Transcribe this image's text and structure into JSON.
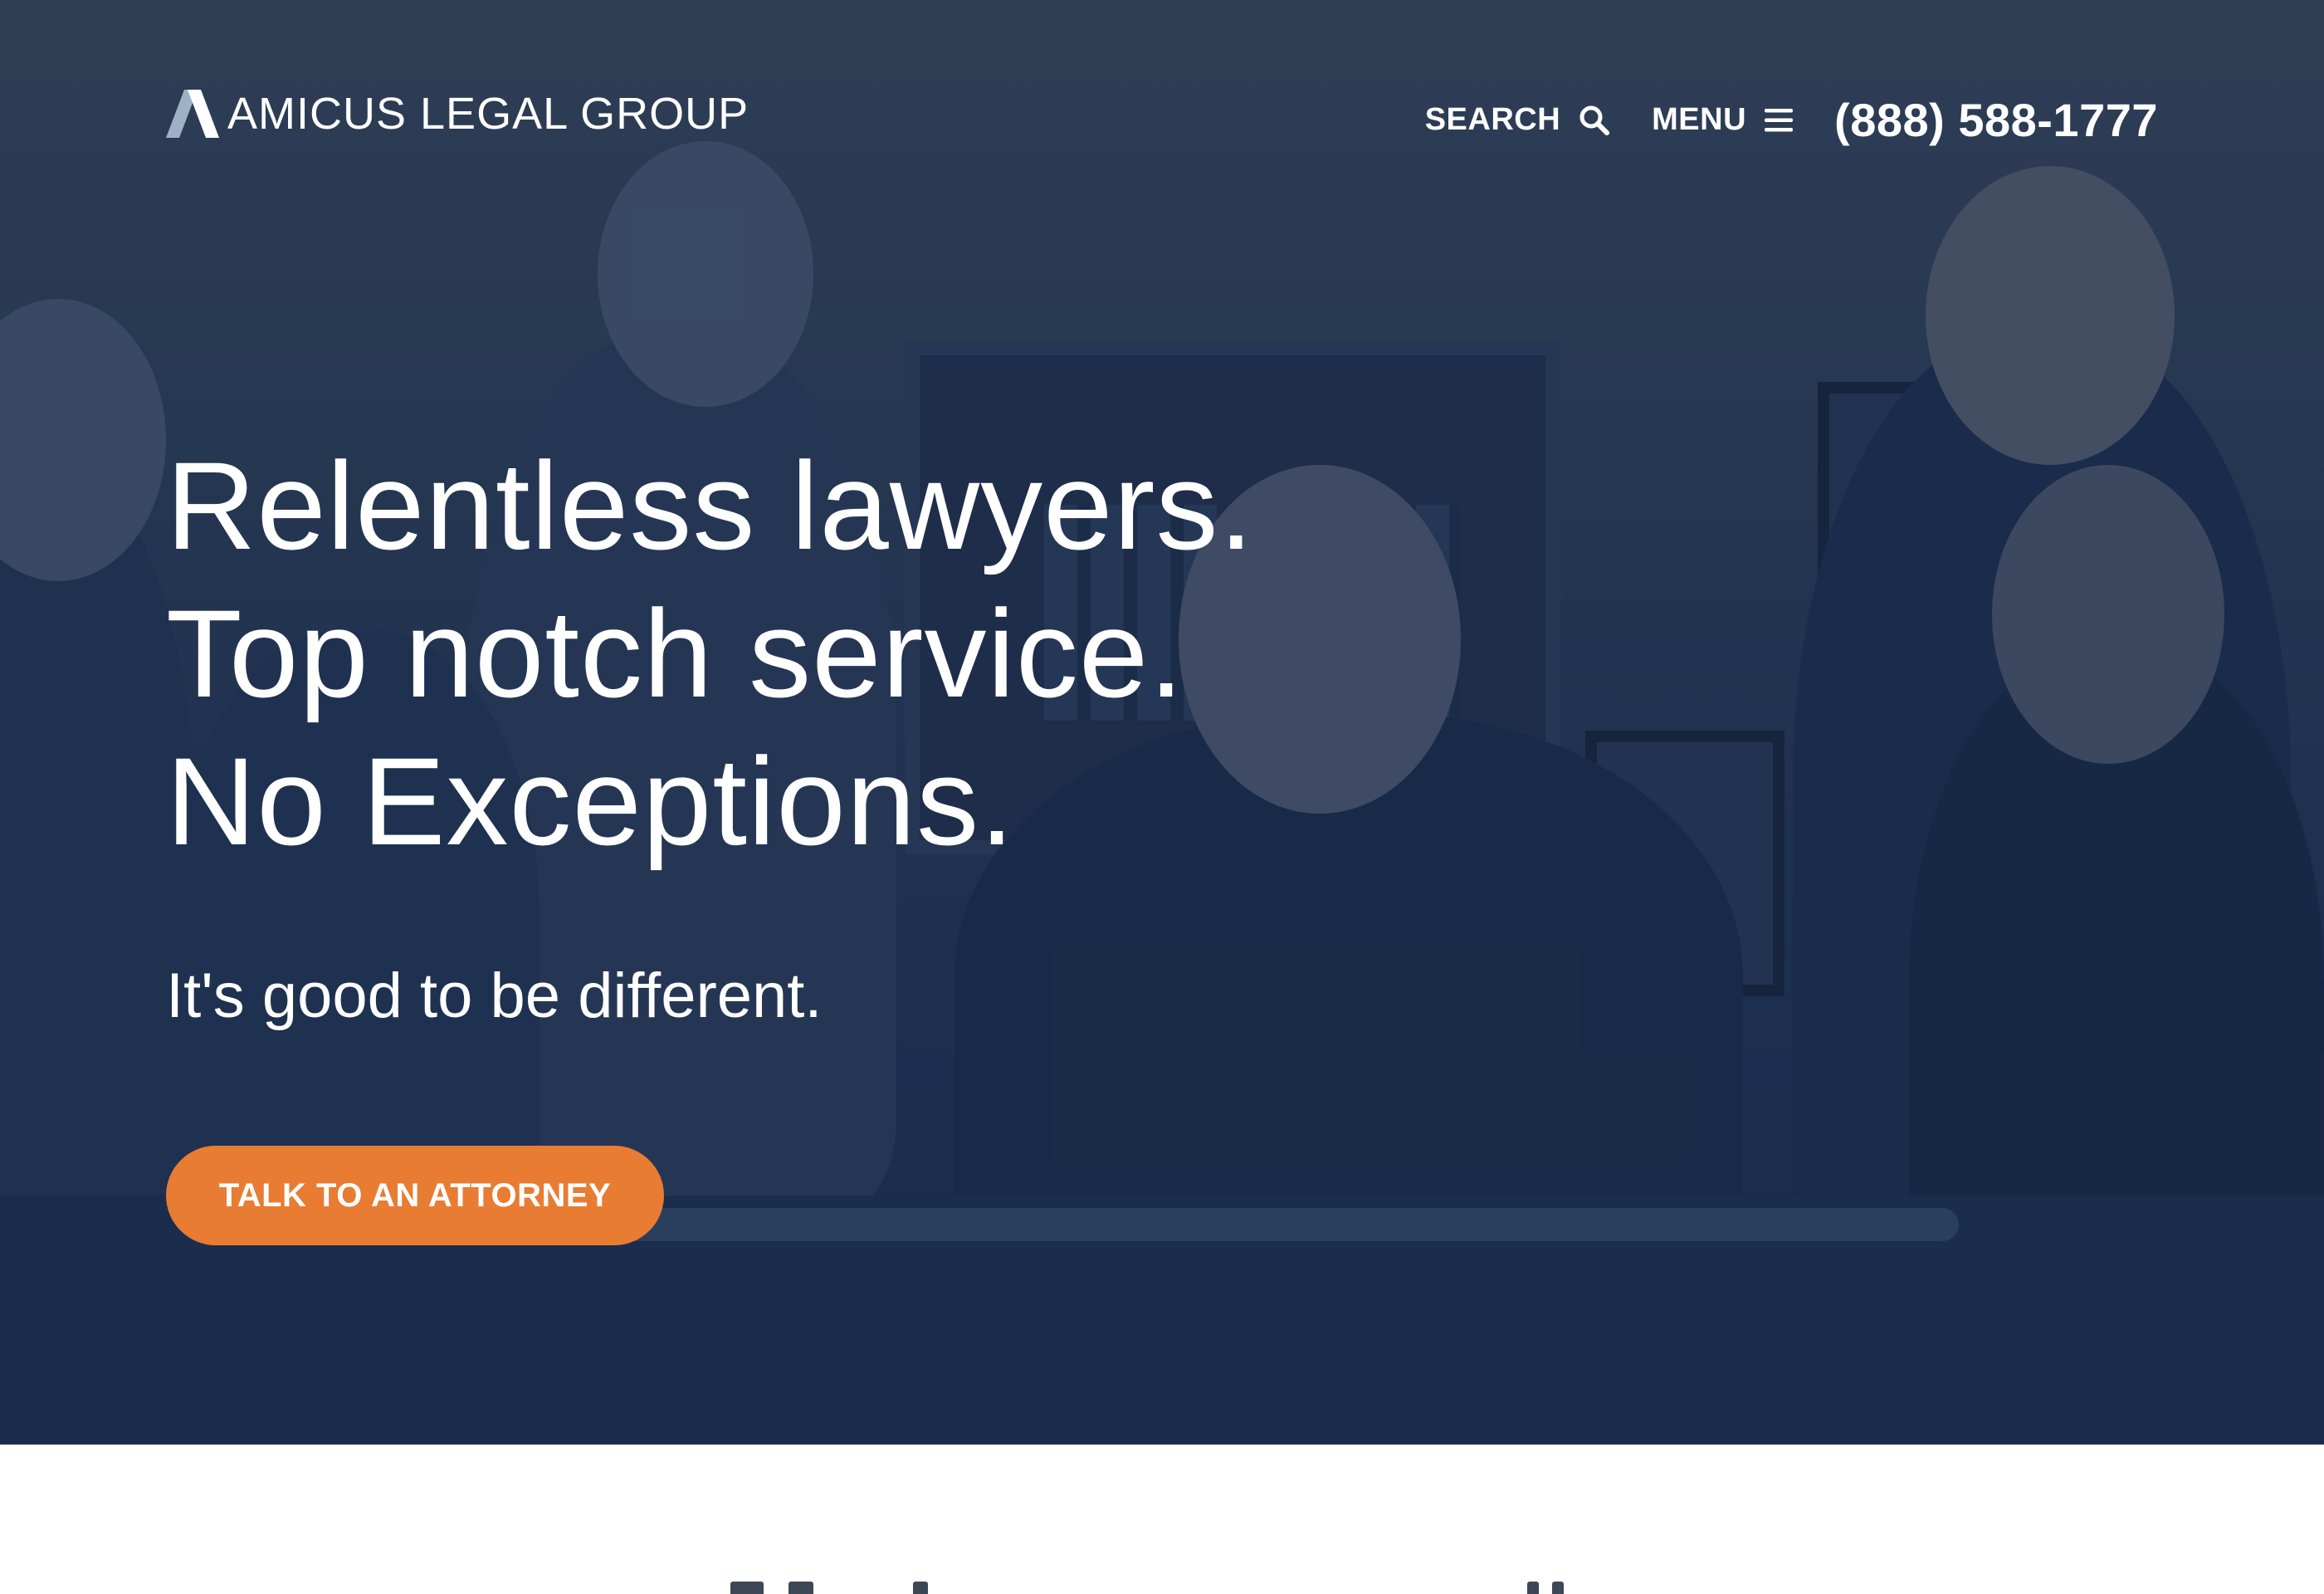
{
  "brand": {
    "name": "AMICUS LEGAL GROUP",
    "logo_icon": "stylized-A-logo-icon"
  },
  "nav": {
    "search_label": "SEARCH",
    "search_icon": "search-icon",
    "menu_label": "MENU",
    "menu_icon": "hamburger-menu-icon",
    "phone": "(888) 588-1777"
  },
  "hero": {
    "headline": [
      "Relentless lawyers.",
      "Top notch service.",
      "No Exceptions."
    ],
    "subheadline": "It's good to be different.",
    "cta_label": "TALK TO AN ATTORNEY"
  },
  "colors": {
    "hero_overlay": "#22365a",
    "cta": "#e87c33",
    "text": "#ffffff"
  }
}
